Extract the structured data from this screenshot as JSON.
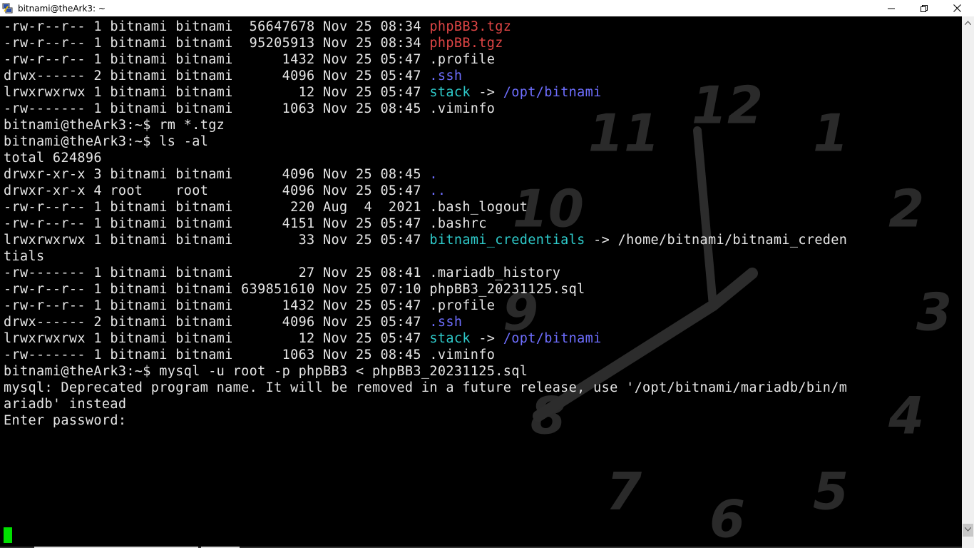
{
  "window": {
    "title": "bitnami@theArk3: ~",
    "icon": "putty-icon",
    "controls": {
      "minimize": "minimize-icon",
      "maximize": "restore-icon",
      "close": "close-icon"
    }
  },
  "terminal": {
    "lines": [
      [
        {
          "t": "-rw-r--r-- 1 bitnami bitnami  56647678 Nov 25 08:34 ",
          "c": ""
        },
        {
          "t": "phpBB3.tgz",
          "c": "red"
        }
      ],
      [
        {
          "t": "-rw-r--r-- 1 bitnami bitnami  95205913 Nov 25 08:34 ",
          "c": ""
        },
        {
          "t": "phpBB.tgz",
          "c": "red"
        }
      ],
      [
        {
          "t": "-rw-r--r-- 1 bitnami bitnami      1432 Nov 25 05:47 .profile",
          "c": ""
        }
      ],
      [
        {
          "t": "drwx------ 2 bitnami bitnami      4096 Nov 25 05:47 ",
          "c": ""
        },
        {
          "t": ".ssh",
          "c": "blue"
        }
      ],
      [
        {
          "t": "lrwxrwxrwx 1 bitnami bitnami        12 Nov 25 05:47 ",
          "c": ""
        },
        {
          "t": "stack",
          "c": "cyan"
        },
        {
          "t": " -> ",
          "c": ""
        },
        {
          "t": "/opt/bitnami",
          "c": "blue"
        }
      ],
      [
        {
          "t": "-rw------- 1 bitnami bitnami      1063 Nov 25 08:45 .viminfo",
          "c": ""
        }
      ],
      [
        {
          "t": "bitnami@theArk3:~$ rm *.tgz",
          "c": ""
        }
      ],
      [
        {
          "t": "bitnami@theArk3:~$ ls -al",
          "c": ""
        }
      ],
      [
        {
          "t": "total 624896",
          "c": ""
        }
      ],
      [
        {
          "t": "drwxr-xr-x 3 bitnami bitnami      4096 Nov 25 08:45 ",
          "c": ""
        },
        {
          "t": ".",
          "c": "blue"
        }
      ],
      [
        {
          "t": "drwxr-xr-x 4 root    root         4096 Nov 25 05:47 ",
          "c": ""
        },
        {
          "t": "..",
          "c": "blue"
        }
      ],
      [
        {
          "t": "-rw-r--r-- 1 bitnami bitnami       220 Aug  4  2021 .bash_logout",
          "c": ""
        }
      ],
      [
        {
          "t": "-rw-r--r-- 1 bitnami bitnami      4151 Nov 25 05:47 .bashrc",
          "c": ""
        }
      ],
      [
        {
          "t": "lrwxrwxrwx 1 bitnami bitnami        33 Nov 25 05:47 ",
          "c": ""
        },
        {
          "t": "bitnami_credentials",
          "c": "cyan"
        },
        {
          "t": " -> /home/bitnami/bitnami_creden",
          "c": ""
        }
      ],
      [
        {
          "t": "tials",
          "c": ""
        }
      ],
      [
        {
          "t": "-rw------- 1 bitnami bitnami        27 Nov 25 08:41 .mariadb_history",
          "c": ""
        }
      ],
      [
        {
          "t": "-rw-r--r-- 1 bitnami bitnami 639851610 Nov 25 07:10 phpBB3_20231125.sql",
          "c": ""
        }
      ],
      [
        {
          "t": "-rw-r--r-- 1 bitnami bitnami      1432 Nov 25 05:47 .profile",
          "c": ""
        }
      ],
      [
        {
          "t": "drwx------ 2 bitnami bitnami      4096 Nov 25 05:47 ",
          "c": ""
        },
        {
          "t": ".ssh",
          "c": "blue"
        }
      ],
      [
        {
          "t": "lrwxrwxrwx 1 bitnami bitnami        12 Nov 25 05:47 ",
          "c": ""
        },
        {
          "t": "stack",
          "c": "cyan"
        },
        {
          "t": " -> ",
          "c": ""
        },
        {
          "t": "/opt/bitnami",
          "c": "blue"
        }
      ],
      [
        {
          "t": "-rw------- 1 bitnami bitnami      1063 Nov 25 08:45 .viminfo",
          "c": ""
        }
      ],
      [
        {
          "t": "bitnami@theArk3:~$ mysql -u root -p phpBB3 < phpBB3_20231125.sql",
          "c": ""
        }
      ],
      [
        {
          "t": "mysql: Deprecated program name. It will be removed in a future release, use '/opt/bitnami/mariadb/bin/m",
          "c": ""
        }
      ],
      [
        {
          "t": "ariadb' instead",
          "c": ""
        }
      ],
      [
        {
          "t": "Enter password: ",
          "c": ""
        }
      ]
    ]
  },
  "wallpaper": {
    "clock_numerals": [
      "12",
      "1",
      "2",
      "3",
      "4",
      "5",
      "6",
      "7",
      "8",
      "9",
      "10",
      "11"
    ]
  },
  "scrollbar": {
    "up": "scroll-up-arrow-icon",
    "down": "scroll-down-arrow-icon"
  },
  "colors": {
    "red": "#e04545",
    "blue": "#6e6eff",
    "cyan": "#2ec9c9",
    "cursor": "#00e000",
    "text": "#e6e6e6"
  }
}
